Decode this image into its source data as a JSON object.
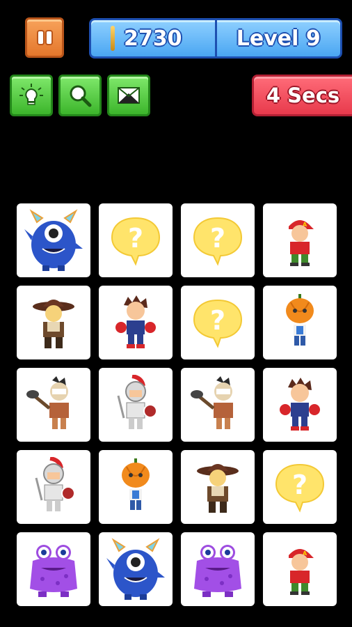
{
  "hud": {
    "score": "2730",
    "level": "Level 9",
    "timer": "4 Secs"
  },
  "tools": [
    {
      "name": "hint-bulb-button",
      "icon": "lightbulb-icon"
    },
    {
      "name": "reveal-search-button",
      "icon": "magnifier-icon"
    },
    {
      "name": "envelope-button",
      "icon": "envelope-icon"
    }
  ],
  "board": {
    "rows": 5,
    "cols": 4,
    "cards": [
      [
        "blue-monster",
        "hidden",
        "hidden",
        "red-cap-boy"
      ],
      [
        "cowboy",
        "boxer-boy",
        "hidden",
        "pumpkin-head"
      ],
      [
        "caveman-club",
        "knight",
        "caveman-club",
        "boxer-boy"
      ],
      [
        "knight",
        "pumpkin-head",
        "cowboy",
        "hidden"
      ],
      [
        "purple-monster",
        "blue-monster",
        "purple-monster",
        "red-cap-boy"
      ]
    ]
  },
  "colors": {
    "pause": "#e4772c",
    "panel": "#4aa6f2",
    "tool": "#3cb52b",
    "timer": "#e83a4c",
    "hidden_bubble": "#ffe46b"
  }
}
